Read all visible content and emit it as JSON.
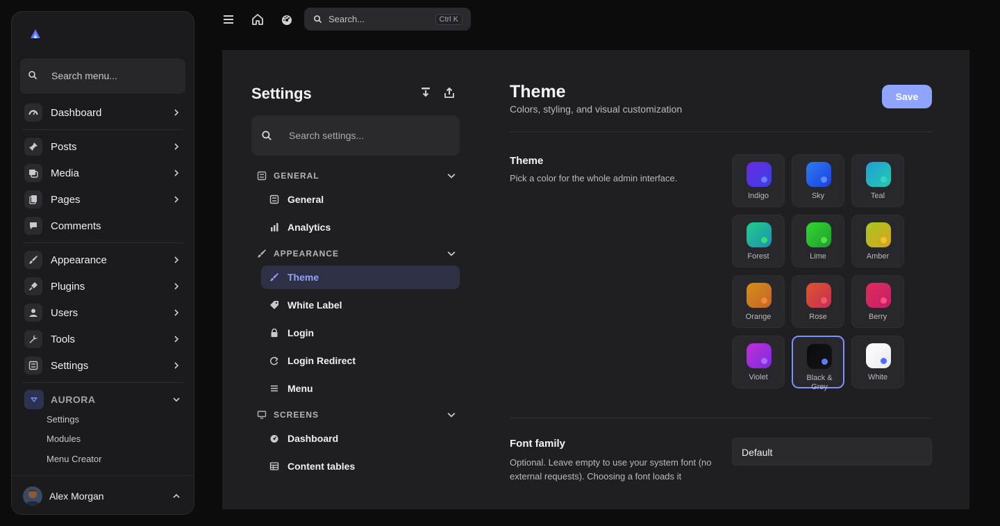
{
  "sidebar": {
    "search_placeholder": "Search menu...",
    "items": [
      {
        "label": "Dashboard",
        "icon": "dashboard-icon"
      },
      {
        "label": "Posts",
        "icon": "pin-icon"
      },
      {
        "label": "Media",
        "icon": "media-icon"
      },
      {
        "label": "Pages",
        "icon": "pages-icon"
      },
      {
        "label": "Comments",
        "icon": "comment-icon"
      },
      {
        "label": "Appearance",
        "icon": "brush-icon"
      },
      {
        "label": "Plugins",
        "icon": "plug-icon"
      },
      {
        "label": "Users",
        "icon": "user-icon"
      },
      {
        "label": "Tools",
        "icon": "wrench-icon"
      },
      {
        "label": "Settings",
        "icon": "settings-icon"
      }
    ],
    "aurora": {
      "label": "AURORA",
      "sub_items": [
        "Settings",
        "Modules",
        "Menu Creator"
      ]
    },
    "user": {
      "name": "Alex Morgan"
    }
  },
  "topbar": {
    "search_placeholder": "Search...",
    "shortcut": "Ctrl K"
  },
  "settings": {
    "title": "Settings",
    "search_placeholder": "Search settings...",
    "sections": [
      {
        "label": "GENERAL",
        "items": [
          "General",
          "Analytics"
        ]
      },
      {
        "label": "APPEARANCE",
        "items": [
          "Theme",
          "White Label",
          "Login",
          "Login Redirect",
          "Menu"
        ]
      },
      {
        "label": "SCREENS",
        "items": [
          "Dashboard",
          "Content tables"
        ]
      }
    ],
    "active_item": "Theme"
  },
  "content": {
    "title": "Theme",
    "subtitle": "Colors, styling, and visual customization",
    "save_label": "Save",
    "theme_label": "Theme",
    "theme_desc": "Pick a color for the whole admin interface.",
    "themes": [
      {
        "name": "Indigo",
        "c1": "#6a2be0",
        "c2": "#3a3fe6",
        "dot": "#6a7cff"
      },
      {
        "name": "Sky",
        "c1": "#2b7cf0",
        "c2": "#1d3fe0",
        "dot": "#5b8cff"
      },
      {
        "name": "Teal",
        "c1": "#1e9fd6",
        "c2": "#27c9b0",
        "dot": "#33d6c0"
      },
      {
        "name": "Forest",
        "c1": "#1fcf8a",
        "c2": "#1f8fb0",
        "dot": "#33e07a"
      },
      {
        "name": "Lime",
        "c1": "#33d632",
        "c2": "#1e9e2c",
        "dot": "#55e04a"
      },
      {
        "name": "Amber",
        "c1": "#a9c823",
        "c2": "#d6a21c",
        "dot": "#f2c230"
      },
      {
        "name": "Orange",
        "c1": "#d68f18",
        "c2": "#c4622a",
        "dot": "#f08a3a"
      },
      {
        "name": "Rose",
        "c1": "#e0532b",
        "c2": "#c42f55",
        "dot": "#ef5a6a"
      },
      {
        "name": "Berry",
        "c1": "#e02b5a",
        "c2": "#c21f6a",
        "dot": "#ff4f80"
      },
      {
        "name": "Violet",
        "c1": "#c22fd6",
        "c2": "#7a2be0",
        "dot": "#a86bff"
      },
      {
        "name": "Black & Grey",
        "c1": "#0b0b0c",
        "c2": "#141416",
        "dot": "#5b7cff",
        "selected": true
      },
      {
        "name": "White",
        "c1": "#ffffff",
        "c2": "#e9e9ee",
        "dot": "#4f6cff"
      }
    ],
    "font_label": "Font family",
    "font_desc": "Optional. Leave empty to use your system font (no external requests). Choosing a font loads it",
    "font_value": "Default"
  },
  "colors": {
    "accent": "#8ea4ff",
    "background": "#0c0c0d",
    "panel": "#1f1f22"
  }
}
